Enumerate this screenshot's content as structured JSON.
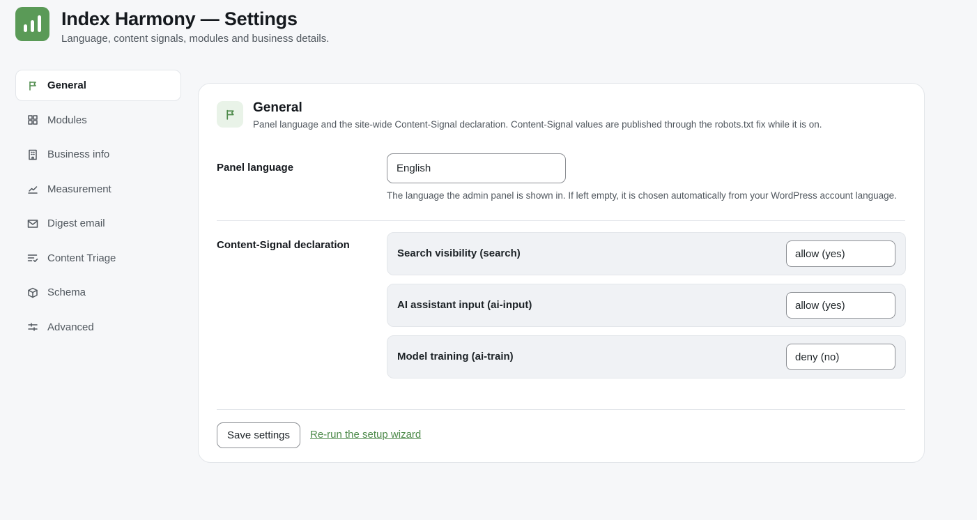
{
  "header": {
    "title": "Index Harmony — Settings",
    "subtitle": "Language, content signals, modules and business details.",
    "logo_icon": "bar-chart-icon",
    "brand_color": "#5a9a57"
  },
  "sidebar": {
    "items": [
      {
        "label": "General",
        "icon": "flag-icon",
        "active": true
      },
      {
        "label": "Modules",
        "icon": "grid-icon",
        "active": false
      },
      {
        "label": "Business info",
        "icon": "building-icon",
        "active": false
      },
      {
        "label": "Measurement",
        "icon": "line-chart-icon",
        "active": false
      },
      {
        "label": "Digest email",
        "icon": "mail-icon",
        "active": false
      },
      {
        "label": "Content Triage",
        "icon": "list-check-icon",
        "active": false
      },
      {
        "label": "Schema",
        "icon": "cube-icon",
        "active": false
      },
      {
        "label": "Advanced",
        "icon": "sliders-icon",
        "active": false
      }
    ]
  },
  "panel": {
    "icon": "flag-icon",
    "title": "General",
    "description": "Panel language and the site-wide Content-Signal declaration. Content-Signal values are published through the robots.txt fix while it is on.",
    "language": {
      "label": "Panel language",
      "value": "English",
      "help": "The language the admin panel is shown in. If left empty, it is chosen automatically from your WordPress account language."
    },
    "content_signal": {
      "label": "Content-Signal declaration",
      "rows": [
        {
          "label": "Search visibility (search)",
          "value": "allow (yes)"
        },
        {
          "label": "AI assistant input (ai-input)",
          "value": "allow (yes)"
        },
        {
          "label": "Model training (ai-train)",
          "value": "deny (no)"
        }
      ]
    },
    "actions": {
      "save_label": "Save settings",
      "wizard_link": "Re-run the setup wizard"
    }
  }
}
